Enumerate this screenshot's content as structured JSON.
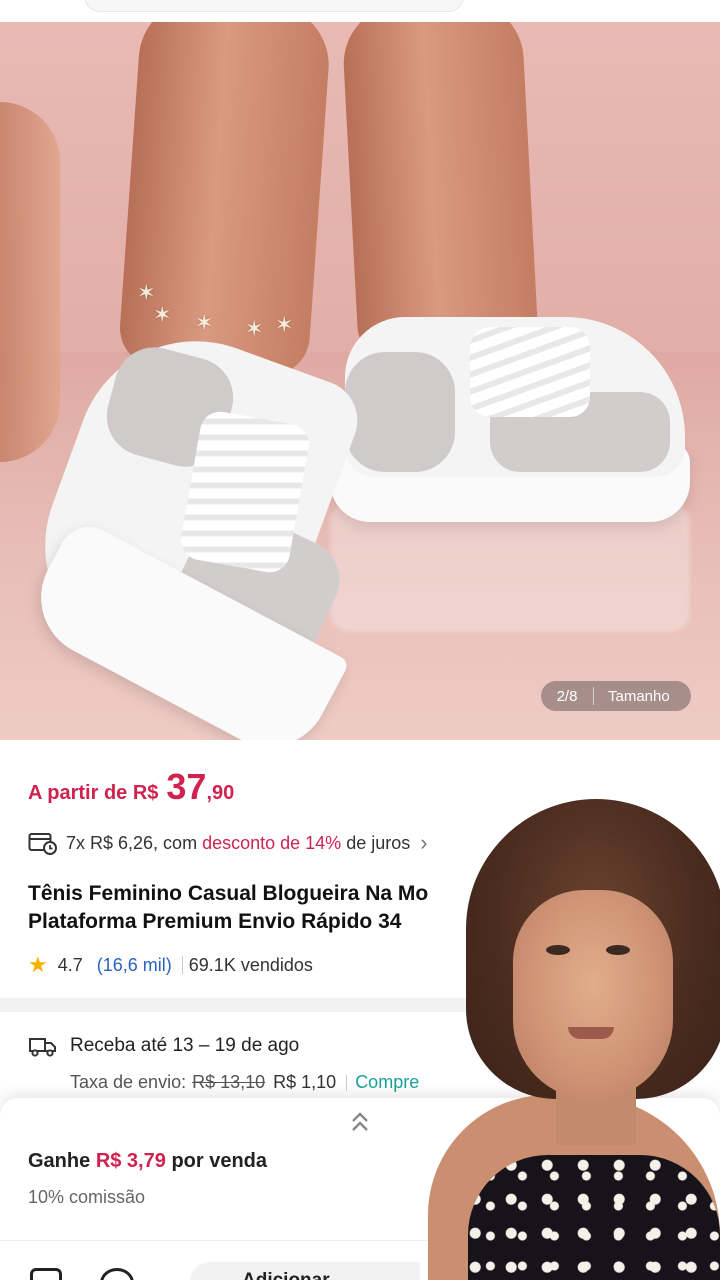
{
  "gallery": {
    "counter": "2/8",
    "size_label": "Tamanho"
  },
  "price": {
    "prefix": "A partir de R$",
    "integer": "37",
    "decimal": ",90"
  },
  "installments": {
    "text_before": "7x R$ 6,26, com",
    "discount": "desconto de 14%",
    "text_after": "de juros"
  },
  "product": {
    "title_line1": "Tênis Feminino Casual Blogueira Na Mo",
    "title_line2": "Plataforma Premium Envio Rápido 34"
  },
  "rating": {
    "score": "4.7",
    "reviews": "(16,6 mil)",
    "sold": "69.1K vendidos"
  },
  "shipping": {
    "delivery": "Receba até 13 – 19 de ago",
    "fee_label": "Taxa de envio:",
    "fee_old": "R$ 13,10",
    "fee_new": "R$ 1,10",
    "fee_link": "Compre"
  },
  "affiliate": {
    "earn_prefix": "Ganhe",
    "earn_amount": "R$ 3,79",
    "earn_suffix": "por venda",
    "commission": "10% comissão"
  },
  "bottom_bar": {
    "add_label": "Adicionar"
  },
  "colors": {
    "accent": "#d0224f",
    "link_blue": "#2a62c4",
    "teal": "#1aa39a",
    "star": "#f5b301"
  }
}
